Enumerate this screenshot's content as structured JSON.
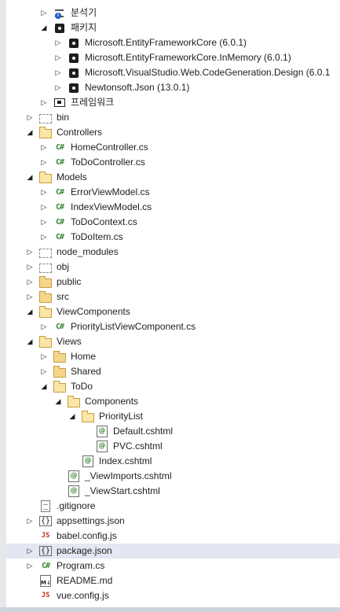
{
  "tree": {
    "items": [
      {
        "label": "분석기",
        "icon": "analyzer-icon",
        "arrow": "right"
      },
      {
        "label": "패키지",
        "icon": "package-icon",
        "arrow": "down"
      },
      {
        "label": "Microsoft.EntityFrameworkCore (6.0.1)",
        "icon": "package-icon",
        "arrow": "right"
      },
      {
        "label": "Microsoft.EntityFrameworkCore.InMemory (6.0.1)",
        "icon": "package-icon",
        "arrow": "right"
      },
      {
        "label": "Microsoft.VisualStudio.Web.CodeGeneration.Design (6.0.1",
        "icon": "package-icon",
        "arrow": "right"
      },
      {
        "label": "Newtonsoft.Json (13.0.1)",
        "icon": "package-icon",
        "arrow": "right"
      },
      {
        "label": "프레임워크",
        "icon": "framework-icon",
        "arrow": "right"
      },
      {
        "label": "bin",
        "icon": "excluded-folder-icon",
        "arrow": "right"
      },
      {
        "label": "Controllers",
        "icon": "folder-open-icon",
        "arrow": "down"
      },
      {
        "label": "HomeController.cs",
        "icon": "csharp-file-icon",
        "arrow": "right"
      },
      {
        "label": "ToDoController.cs",
        "icon": "csharp-file-icon",
        "arrow": "right"
      },
      {
        "label": "Models",
        "icon": "folder-open-icon",
        "arrow": "down"
      },
      {
        "label": "ErrorViewModel.cs",
        "icon": "csharp-file-icon",
        "arrow": "right"
      },
      {
        "label": "IndexViewModel.cs",
        "icon": "csharp-file-icon",
        "arrow": "right"
      },
      {
        "label": "ToDoContext.cs",
        "icon": "csharp-file-icon",
        "arrow": "right"
      },
      {
        "label": "ToDoItem.cs",
        "icon": "csharp-file-icon",
        "arrow": "right"
      },
      {
        "label": "node_modules",
        "icon": "excluded-folder-icon",
        "arrow": "right"
      },
      {
        "label": "obj",
        "icon": "excluded-folder-icon",
        "arrow": "right"
      },
      {
        "label": "public",
        "icon": "folder-icon",
        "arrow": "right"
      },
      {
        "label": "src",
        "icon": "folder-icon",
        "arrow": "right"
      },
      {
        "label": "ViewComponents",
        "icon": "folder-open-icon",
        "arrow": "down"
      },
      {
        "label": "PriorityListViewComponent.cs",
        "icon": "csharp-file-icon",
        "arrow": "right"
      },
      {
        "label": "Views",
        "icon": "folder-open-icon",
        "arrow": "down"
      },
      {
        "label": "Home",
        "icon": "folder-icon",
        "arrow": "right"
      },
      {
        "label": "Shared",
        "icon": "folder-icon",
        "arrow": "right"
      },
      {
        "label": "ToDo",
        "icon": "folder-open-icon",
        "arrow": "down"
      },
      {
        "label": "Components",
        "icon": "folder-open-icon",
        "arrow": "down"
      },
      {
        "label": "PriorityList",
        "icon": "folder-open-icon",
        "arrow": "down"
      },
      {
        "label": "Default.cshtml",
        "icon": "razor-file-icon",
        "arrow": "none"
      },
      {
        "label": "PVC.cshtml",
        "icon": "razor-file-icon",
        "arrow": "none"
      },
      {
        "label": "Index.cshtml",
        "icon": "razor-file-icon",
        "arrow": "none"
      },
      {
        "label": "_ViewImports.cshtml",
        "icon": "razor-file-icon",
        "arrow": "none"
      },
      {
        "label": "_ViewStart.cshtml",
        "icon": "razor-file-icon",
        "arrow": "none"
      },
      {
        "label": ".gitignore",
        "icon": "text-file-icon",
        "arrow": "none"
      },
      {
        "label": "appsettings.json",
        "icon": "json-file-icon",
        "arrow": "right"
      },
      {
        "label": "babel.config.js",
        "icon": "js-file-icon",
        "arrow": "none"
      },
      {
        "label": "package.json",
        "icon": "json-file-icon",
        "arrow": "right"
      },
      {
        "label": "Program.cs",
        "icon": "csharp-file-icon",
        "arrow": "right"
      },
      {
        "label": "README.md",
        "icon": "markdown-file-icon",
        "arrow": "none"
      },
      {
        "label": "vue.config.js",
        "icon": "js-file-icon",
        "arrow": "none"
      }
    ],
    "selected_label": "package.json"
  },
  "glyphs": {
    "csharp": "C#",
    "js": "JS",
    "json": "{}",
    "razor": "@",
    "markdown": "M↓"
  }
}
